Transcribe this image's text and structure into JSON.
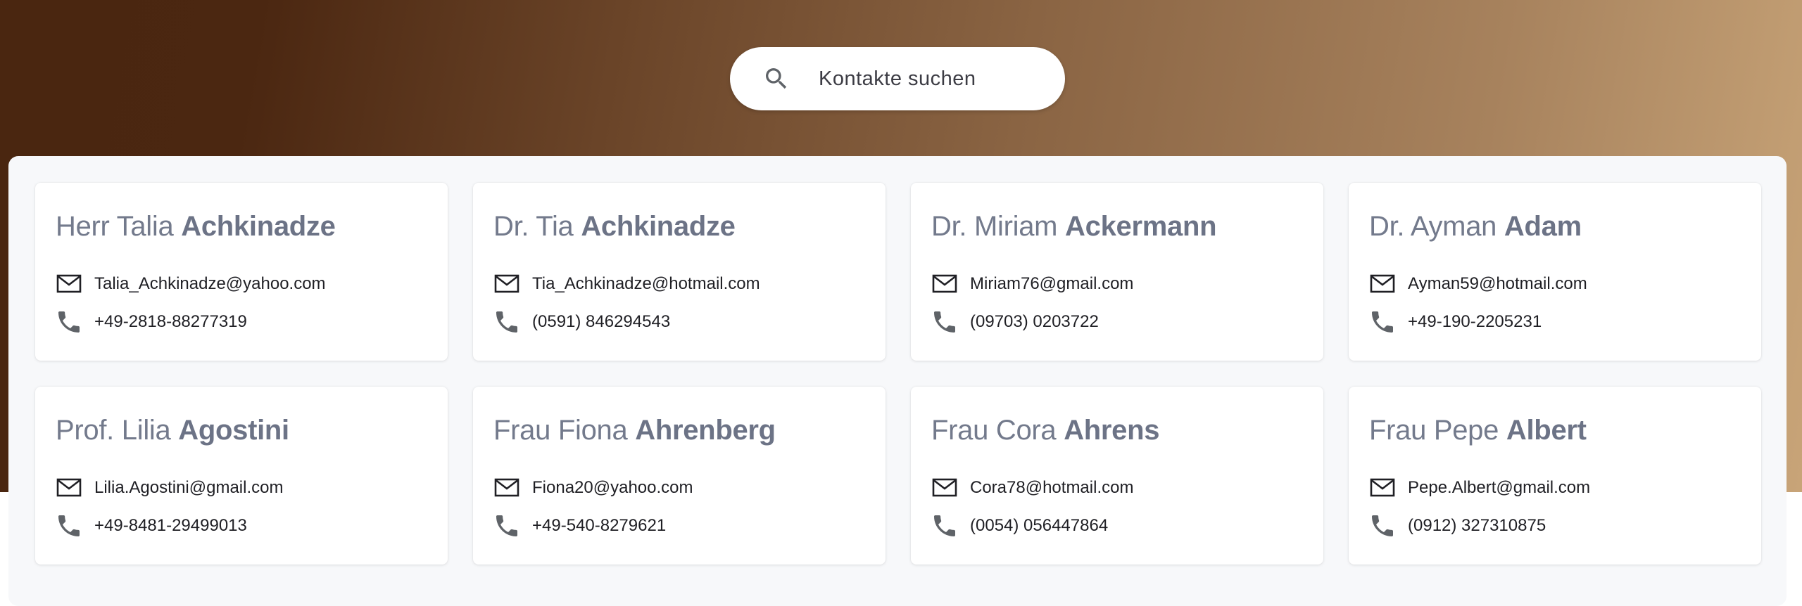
{
  "search": {
    "placeholder": "Kontakte suchen"
  },
  "contacts": [
    {
      "prefix": "Herr Talia",
      "surname": "Achkinadze",
      "email": "Talia_Achkinadze@yahoo.com",
      "phone": "+49-2818-88277319"
    },
    {
      "prefix": "Dr. Tia",
      "surname": "Achkinadze",
      "email": "Tia_Achkinadze@hotmail.com",
      "phone": "(0591) 846294543"
    },
    {
      "prefix": "Dr. Miriam",
      "surname": "Ackermann",
      "email": "Miriam76@gmail.com",
      "phone": "(09703) 0203722"
    },
    {
      "prefix": "Dr. Ayman",
      "surname": "Adam",
      "email": "Ayman59@hotmail.com",
      "phone": "+49-190-2205231"
    },
    {
      "prefix": "Prof. Lilia",
      "surname": "Agostini",
      "email": "Lilia.Agostini@gmail.com",
      "phone": "+49-8481-29499013"
    },
    {
      "prefix": "Frau Fiona",
      "surname": "Ahrenberg",
      "email": "Fiona20@yahoo.com",
      "phone": "+49-540-8279621"
    },
    {
      "prefix": "Frau Cora",
      "surname": "Ahrens",
      "email": "Cora78@hotmail.com",
      "phone": "(0054) 056447864"
    },
    {
      "prefix": "Frau Pepe",
      "surname": "Albert",
      "email": "Pepe.Albert@gmail.com",
      "phone": "(0912) 327310875"
    }
  ],
  "icons": {
    "search": "search-icon",
    "email": "mail-icon",
    "phone": "phone-icon"
  },
  "colors": {
    "name_text": "#737a8c",
    "icon": "#5f6368",
    "panel_bg": "#f7f8fa"
  }
}
